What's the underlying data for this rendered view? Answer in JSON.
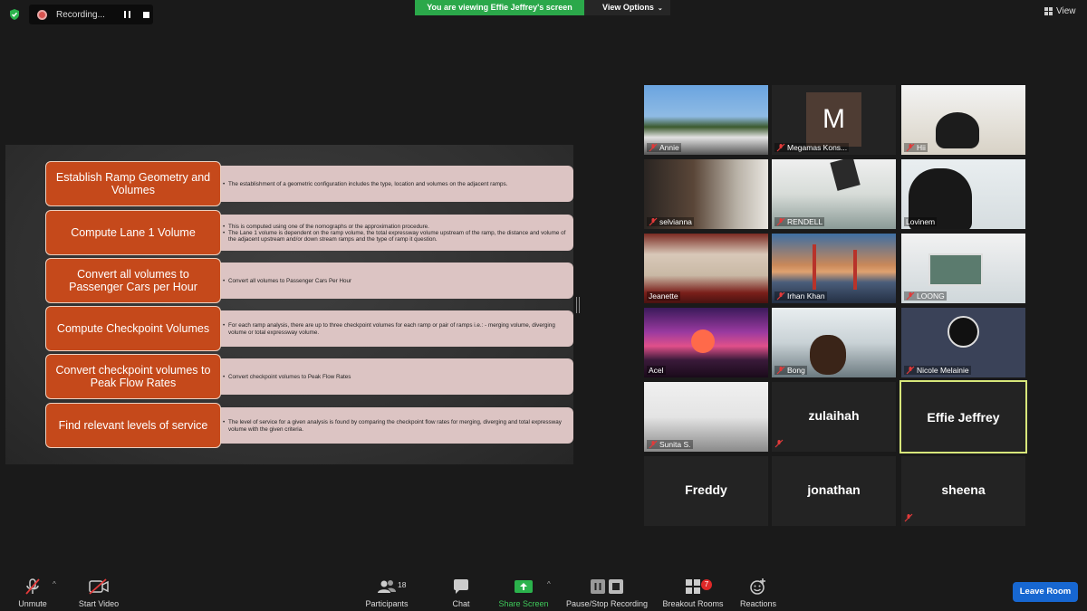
{
  "top_bar": {
    "recording_label": "Recording...",
    "viewing_banner": "You are viewing Effie Jeffrey's screen",
    "view_options": "View Options",
    "view_label": "View"
  },
  "slide": {
    "steps": [
      {
        "title": "Establish Ramp Geometry and Volumes",
        "bullets": [
          "The establishment of a geometric configuration includes the type, location and volumes on the adjacent ramps."
        ]
      },
      {
        "title": "Compute Lane 1 Volume",
        "bullets": [
          "This is computed using one of the nomographs or the approximation procedure.",
          "The Lane 1 volume is dependent on the ramp volume, the total expressway volume upstream of the ramp, the distance and volume of the adjacent upstream and/or down stream ramps and the type of ramp it question."
        ]
      },
      {
        "title": "Convert all volumes to Passenger Cars per Hour",
        "bullets": [
          "Convert all volumes to Passenger Cars Per Hour"
        ]
      },
      {
        "title": "Compute Checkpoint Volumes",
        "bullets": [
          "For each ramp analysis, there are up to three checkpoint volumes for each ramp or pair of ramps i.e.: - merging volume, diverging volume or total expressway volume."
        ]
      },
      {
        "title": "Convert checkpoint volumes to Peak Flow Rates",
        "bullets": [
          "Convert checkpoint volumes to Peak Flow Rates"
        ]
      },
      {
        "title": "Find relevant levels of service",
        "bullets": [
          "The level of service for a given analysis is found by comparing the checkpoint flow rates for merging, diverging and total expressway volume with the given criteria."
        ]
      }
    ]
  },
  "gallery": [
    {
      "name": "Annie"
    },
    {
      "name": "Megamas Kons...",
      "initial": "M"
    },
    {
      "name": "Hii"
    },
    {
      "name": "selvianna"
    },
    {
      "name": "RENDELL"
    },
    {
      "name": "Lovinem"
    },
    {
      "name": "Jeanette"
    },
    {
      "name": "Irhan Khan"
    },
    {
      "name": "LOONG"
    },
    {
      "name": "Acel"
    },
    {
      "name": "Bong"
    },
    {
      "name": "Nicole Melainie"
    },
    {
      "name": "Sunita S."
    },
    {
      "name": "zulaihah"
    },
    {
      "name": "Effie Jeffrey"
    },
    {
      "name": "Freddy"
    },
    {
      "name": "jonathan"
    },
    {
      "name": "sheena"
    }
  ],
  "toolbar": {
    "unmute": "Unmute",
    "start_video": "Start Video",
    "participants": "Participants",
    "participant_count": "18",
    "chat": "Chat",
    "share_screen": "Share Screen",
    "pause_stop_recording": "Pause/Stop Recording",
    "breakout_rooms": "Breakout Rooms",
    "breakout_badge": "7",
    "reactions": "Reactions",
    "leave_room": "Leave Room"
  }
}
